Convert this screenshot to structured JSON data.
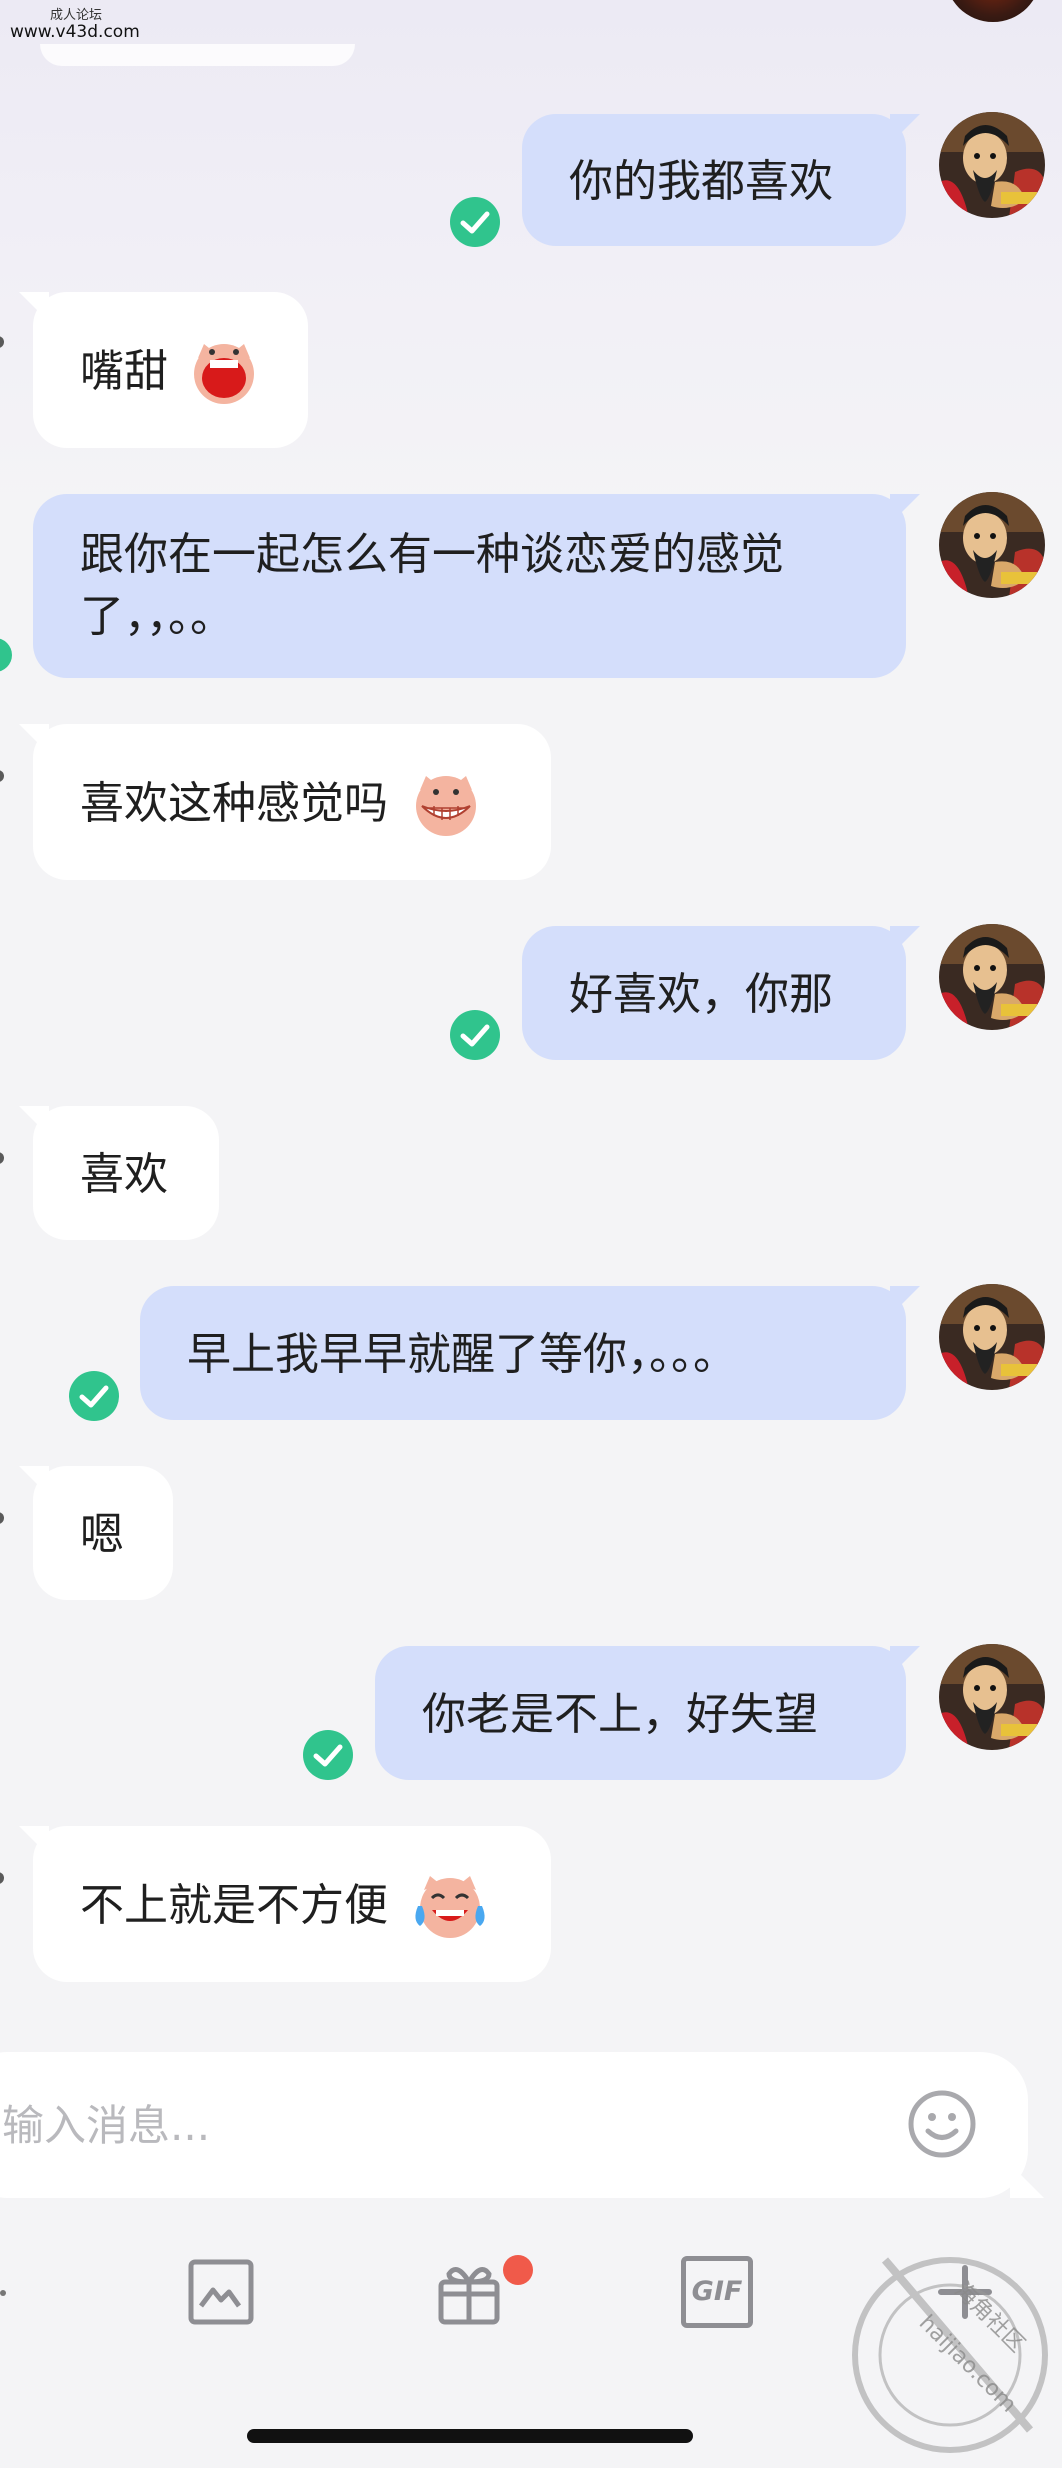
{
  "watermark": {
    "line1": "成人论坛",
    "line2": "www.v43d.com"
  },
  "messages": [
    {
      "side": "sent",
      "text": "你的我都喜欢",
      "status": "read"
    },
    {
      "side": "received",
      "text": "嘴甜",
      "emoji": "laughing-pig-emoji"
    },
    {
      "side": "sent",
      "line1": "跟你在一起怎么有一种谈恋爱的感觉",
      "line2": "了，，。。",
      "status": "read"
    },
    {
      "side": "received",
      "text": "喜欢这种感觉吗",
      "emoji": "grinning-pig-emoji"
    },
    {
      "side": "sent",
      "text": "好喜欢，你那",
      "status": "read"
    },
    {
      "side": "received",
      "text": "喜欢"
    },
    {
      "side": "sent",
      "text": "早上我早早就醒了等你，。。。",
      "status": "read"
    },
    {
      "side": "received",
      "text": "嗯"
    },
    {
      "side": "sent",
      "text": "你老是不上，好失望",
      "status": "read"
    },
    {
      "side": "received",
      "text": "不上就是不方便",
      "emoji": "crying-laughing-pig-emoji"
    }
  ],
  "input": {
    "placeholder": "输入消息..."
  },
  "toolbar": {
    "items": [
      "image-icon",
      "gift-icon",
      "gif-icon",
      "plus-icon"
    ],
    "gif_label": "GIF",
    "gift_has_notification": true
  },
  "stamp": {
    "text": "海角社区",
    "url": "haijiao.com"
  },
  "colors": {
    "sent_bubble": "#d4defb",
    "received_bubble": "#ffffff",
    "check": "#30c48d",
    "badge": "#f05a4a",
    "background": "#f4f4f6"
  }
}
